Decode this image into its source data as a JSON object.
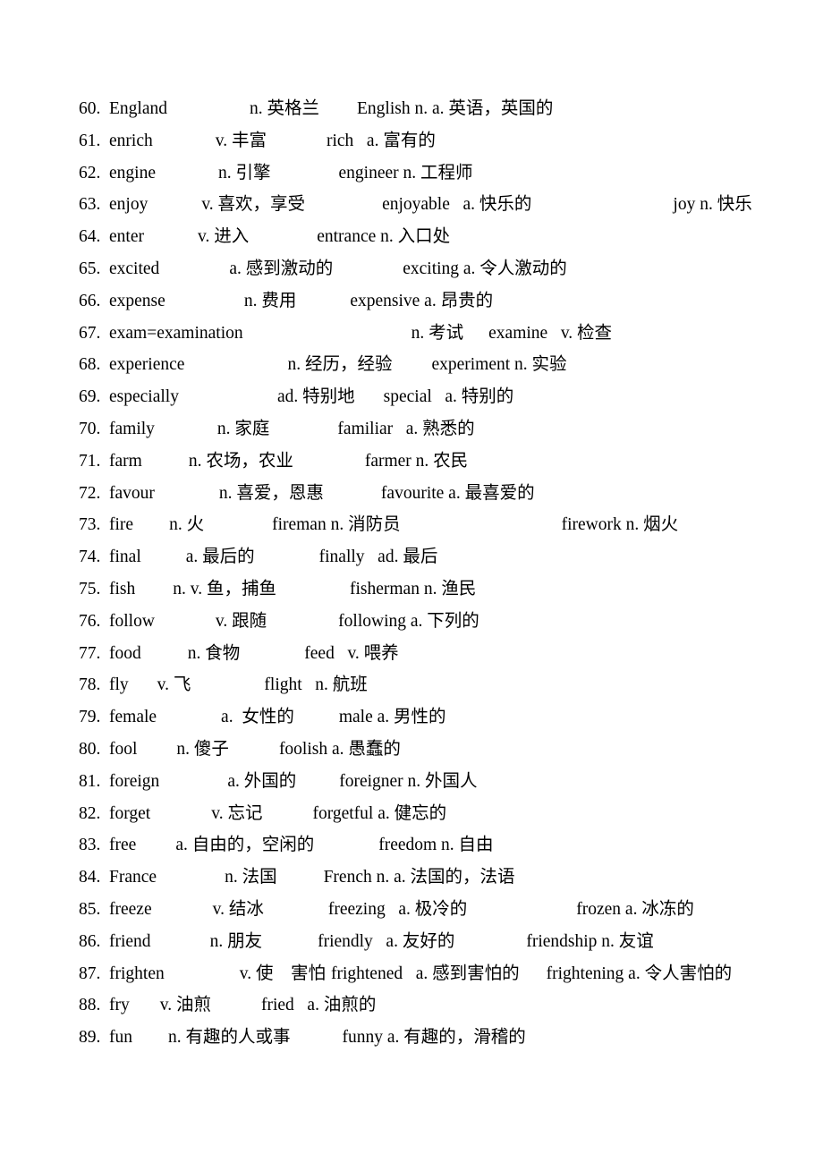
{
  "document": {
    "type": "vocabulary-word-list",
    "text_color": "#000000",
    "background_color": "#ffffff",
    "entries": [
      {
        "index": "60.",
        "word": "England",
        "definition": "n. 英格兰",
        "derived": "English n. a. 英语，英国的",
        "extra": "",
        "word_pad": 92,
        "def_pad": 42,
        "derived_pad": 86,
        "extra_pad": 0
      },
      {
        "index": "61.",
        "word": "enrich",
        "definition": "v. 丰富",
        "derived": "rich   a. 富有的",
        "extra": "",
        "word_pad": 70,
        "def_pad": 67,
        "derived_pad": 86,
        "extra_pad": 0
      },
      {
        "index": "62.",
        "word": "engine",
        "definition": "n. 引擎",
        "derived": "engineer n. 工程师",
        "extra": "",
        "word_pad": 70,
        "def_pad": 76,
        "derived_pad": 90,
        "extra_pad": 0
      },
      {
        "index": "63.",
        "word": "enjoy",
        "definition": "v. 喜欢，享受",
        "derived": "enjoyable   a. 快乐的",
        "extra": "joy n. 快乐",
        "word_pad": 60,
        "def_pad": 86,
        "derived_pad": 40,
        "extra_pad": 118
      },
      {
        "index": "64.",
        "word": "enter",
        "definition": "v. 进入",
        "derived": "entrance n. 入口处",
        "extra": "",
        "word_pad": 60,
        "def_pad": 76,
        "derived_pad": 110,
        "extra_pad": 0
      },
      {
        "index": "65.",
        "word": "excited",
        "definition": "a. 感到激动的",
        "derived": "exciting a. 令人激动的",
        "extra": "",
        "word_pad": 78,
        "def_pad": 78,
        "derived_pad": 56,
        "extra_pad": 0
      },
      {
        "index": "66.",
        "word": "expense",
        "definition": "n. 费用",
        "derived": "expensive a. 昂贵的",
        "extra": "",
        "word_pad": 88,
        "def_pad": 60,
        "derived_pad": 94,
        "extra_pad": 0
      },
      {
        "index": "67.",
        "word": "exam=examination",
        "definition": "n. 考试",
        "derived": "examine   v. 检查",
        "extra": "",
        "word_pad": 188,
        "def_pad": 28,
        "derived_pad": 56,
        "extra_pad": 0
      },
      {
        "index": "68.",
        "word": "experience",
        "definition": "n. 经历，经验",
        "derived": "experiment n. 实验",
        "extra": "",
        "word_pad": 115,
        "def_pad": 44,
        "derived_pad": 46,
        "extra_pad": 0
      },
      {
        "index": "69.",
        "word": "especially",
        "definition": "ad. 特别地",
        "derived": "special   a. 特别的",
        "extra": "",
        "word_pad": 110,
        "def_pad": 32,
        "derived_pad": 76,
        "extra_pad": 0
      },
      {
        "index": "70.",
        "word": "family",
        "definition": "n. 家庭",
        "derived": "familiar   a. 熟悉的",
        "extra": "",
        "word_pad": 70,
        "def_pad": 76,
        "derived_pad": 74,
        "extra_pad": 0
      },
      {
        "index": "71.",
        "word": "farm",
        "definition": "n. 农场，农业",
        "derived": "farmer n. 农民",
        "extra": "",
        "word_pad": 52,
        "def_pad": 80,
        "derived_pad": 56,
        "extra_pad": 0
      },
      {
        "index": "72.",
        "word": "favour",
        "definition": "n. 喜爱，恩惠",
        "derived": "favourite a. 最喜爱的",
        "extra": "",
        "word_pad": 72,
        "def_pad": 64,
        "derived_pad": 52,
        "extra_pad": 0
      },
      {
        "index": "73.",
        "word": "fire",
        "definition": "n. 火",
        "derived": "fireman n. 消防员",
        "extra": "firework n. 烟火",
        "word_pad": 40,
        "def_pad": 76,
        "derived_pad": 96,
        "extra_pad": 84
      },
      {
        "index": "74.",
        "word": "final",
        "definition": "a. 最后的",
        "derived": "finally   ad. 最后",
        "extra": "",
        "word_pad": 50,
        "def_pad": 72,
        "derived_pad": 74,
        "extra_pad": 0
      },
      {
        "index": "75.",
        "word": "fish",
        "definition": "n. v. 鱼，捕鱼",
        "derived": "fisherman n. 渔民",
        "extra": "",
        "word_pad": 42,
        "def_pad": 82,
        "derived_pad": 44,
        "extra_pad": 0
      },
      {
        "index": "76.",
        "word": "follow",
        "definition": "v. 跟随",
        "derived": "following a. 下列的",
        "extra": "",
        "word_pad": 68,
        "def_pad": 80,
        "derived_pad": 90,
        "extra_pad": 0
      },
      {
        "index": "77.",
        "word": "food",
        "definition": "n. 食物",
        "derived": "feed   v. 喂养",
        "extra": "",
        "word_pad": 52,
        "def_pad": 72,
        "derived_pad": 110,
        "extra_pad": 0
      },
      {
        "index": "78.",
        "word": "fly",
        "definition": "v. 飞",
        "derived": "flight   n. 航班",
        "extra": "",
        "word_pad": 32,
        "def_pad": 82,
        "derived_pad": 118,
        "extra_pad": 0
      },
      {
        "index": "79.",
        "word": "female",
        "definition": "a.  女性的",
        "derived": "male a. 男性的",
        "extra": "",
        "word_pad": 72,
        "def_pad": 50,
        "derived_pad": 112,
        "extra_pad": 0
      },
      {
        "index": "80.",
        "word": "fool",
        "definition": "n. 傻子",
        "derived": "foolish a. 愚蠢的",
        "extra": "",
        "word_pad": 44,
        "def_pad": 56,
        "derived_pad": 122,
        "extra_pad": 0
      },
      {
        "index": "81.",
        "word": "foreign",
        "definition": "a. 外国的",
        "derived": "foreigner n. 外国人",
        "extra": "",
        "word_pad": 76,
        "def_pad": 48,
        "derived_pad": 104,
        "extra_pad": 0
      },
      {
        "index": "82.",
        "word": "forget",
        "definition": "v. 忘记",
        "derived": "forgetful a. 健忘的",
        "extra": "",
        "word_pad": 68,
        "def_pad": 56,
        "derived_pad": 114,
        "extra_pad": 0
      },
      {
        "index": "83.",
        "word": "free",
        "definition": "a. 自由的，空闲的",
        "derived": "freedom n. 自由",
        "extra": "",
        "word_pad": 44,
        "def_pad": 72,
        "derived_pad": 42,
        "extra_pad": 0
      },
      {
        "index": "84.",
        "word": "France",
        "definition": "n. 法国",
        "derived": "French n. a. 法国的，法语",
        "extra": "",
        "word_pad": 76,
        "def_pad": 52,
        "derived_pad": 96,
        "extra_pad": 0
      },
      {
        "index": "85.",
        "word": "freeze",
        "definition": "v. 结冰",
        "derived": "freezing   a. 极冷的",
        "extra": "frozen a. 冰冻的",
        "word_pad": 68,
        "def_pad": 72,
        "derived_pad": 36,
        "extra_pad": 86
      },
      {
        "index": "86.",
        "word": "friend",
        "definition": "n. 朋友",
        "derived": "friendly   a. 友好的",
        "extra": "friendship n. 友谊",
        "word_pad": 66,
        "def_pad": 62,
        "derived_pad": 42,
        "extra_pad": 38
      },
      {
        "index": "87.",
        "word": "frighten",
        "definition": "v. 使　害怕",
        "derived": "frightened   a. 感到害怕的",
        "extra": "frightening a. 令人害怕的",
        "word_pad": 84,
        "def_pad": 6,
        "derived_pad": 14,
        "extra_pad": 16
      },
      {
        "index": "88.",
        "word": "fry",
        "definition": "v. 油煎",
        "derived": "fried   a. 油煎的",
        "extra": "",
        "word_pad": 34,
        "def_pad": 56,
        "derived_pad": 122,
        "extra_pad": 0
      },
      {
        "index": "89.",
        "word": "fun",
        "definition": "n. 有趣的人或事",
        "derived": "funny a. 有趣的，滑稽的",
        "extra": "",
        "word_pad": 40,
        "def_pad": 58,
        "derived_pad": 64,
        "extra_pad": 0
      }
    ]
  }
}
